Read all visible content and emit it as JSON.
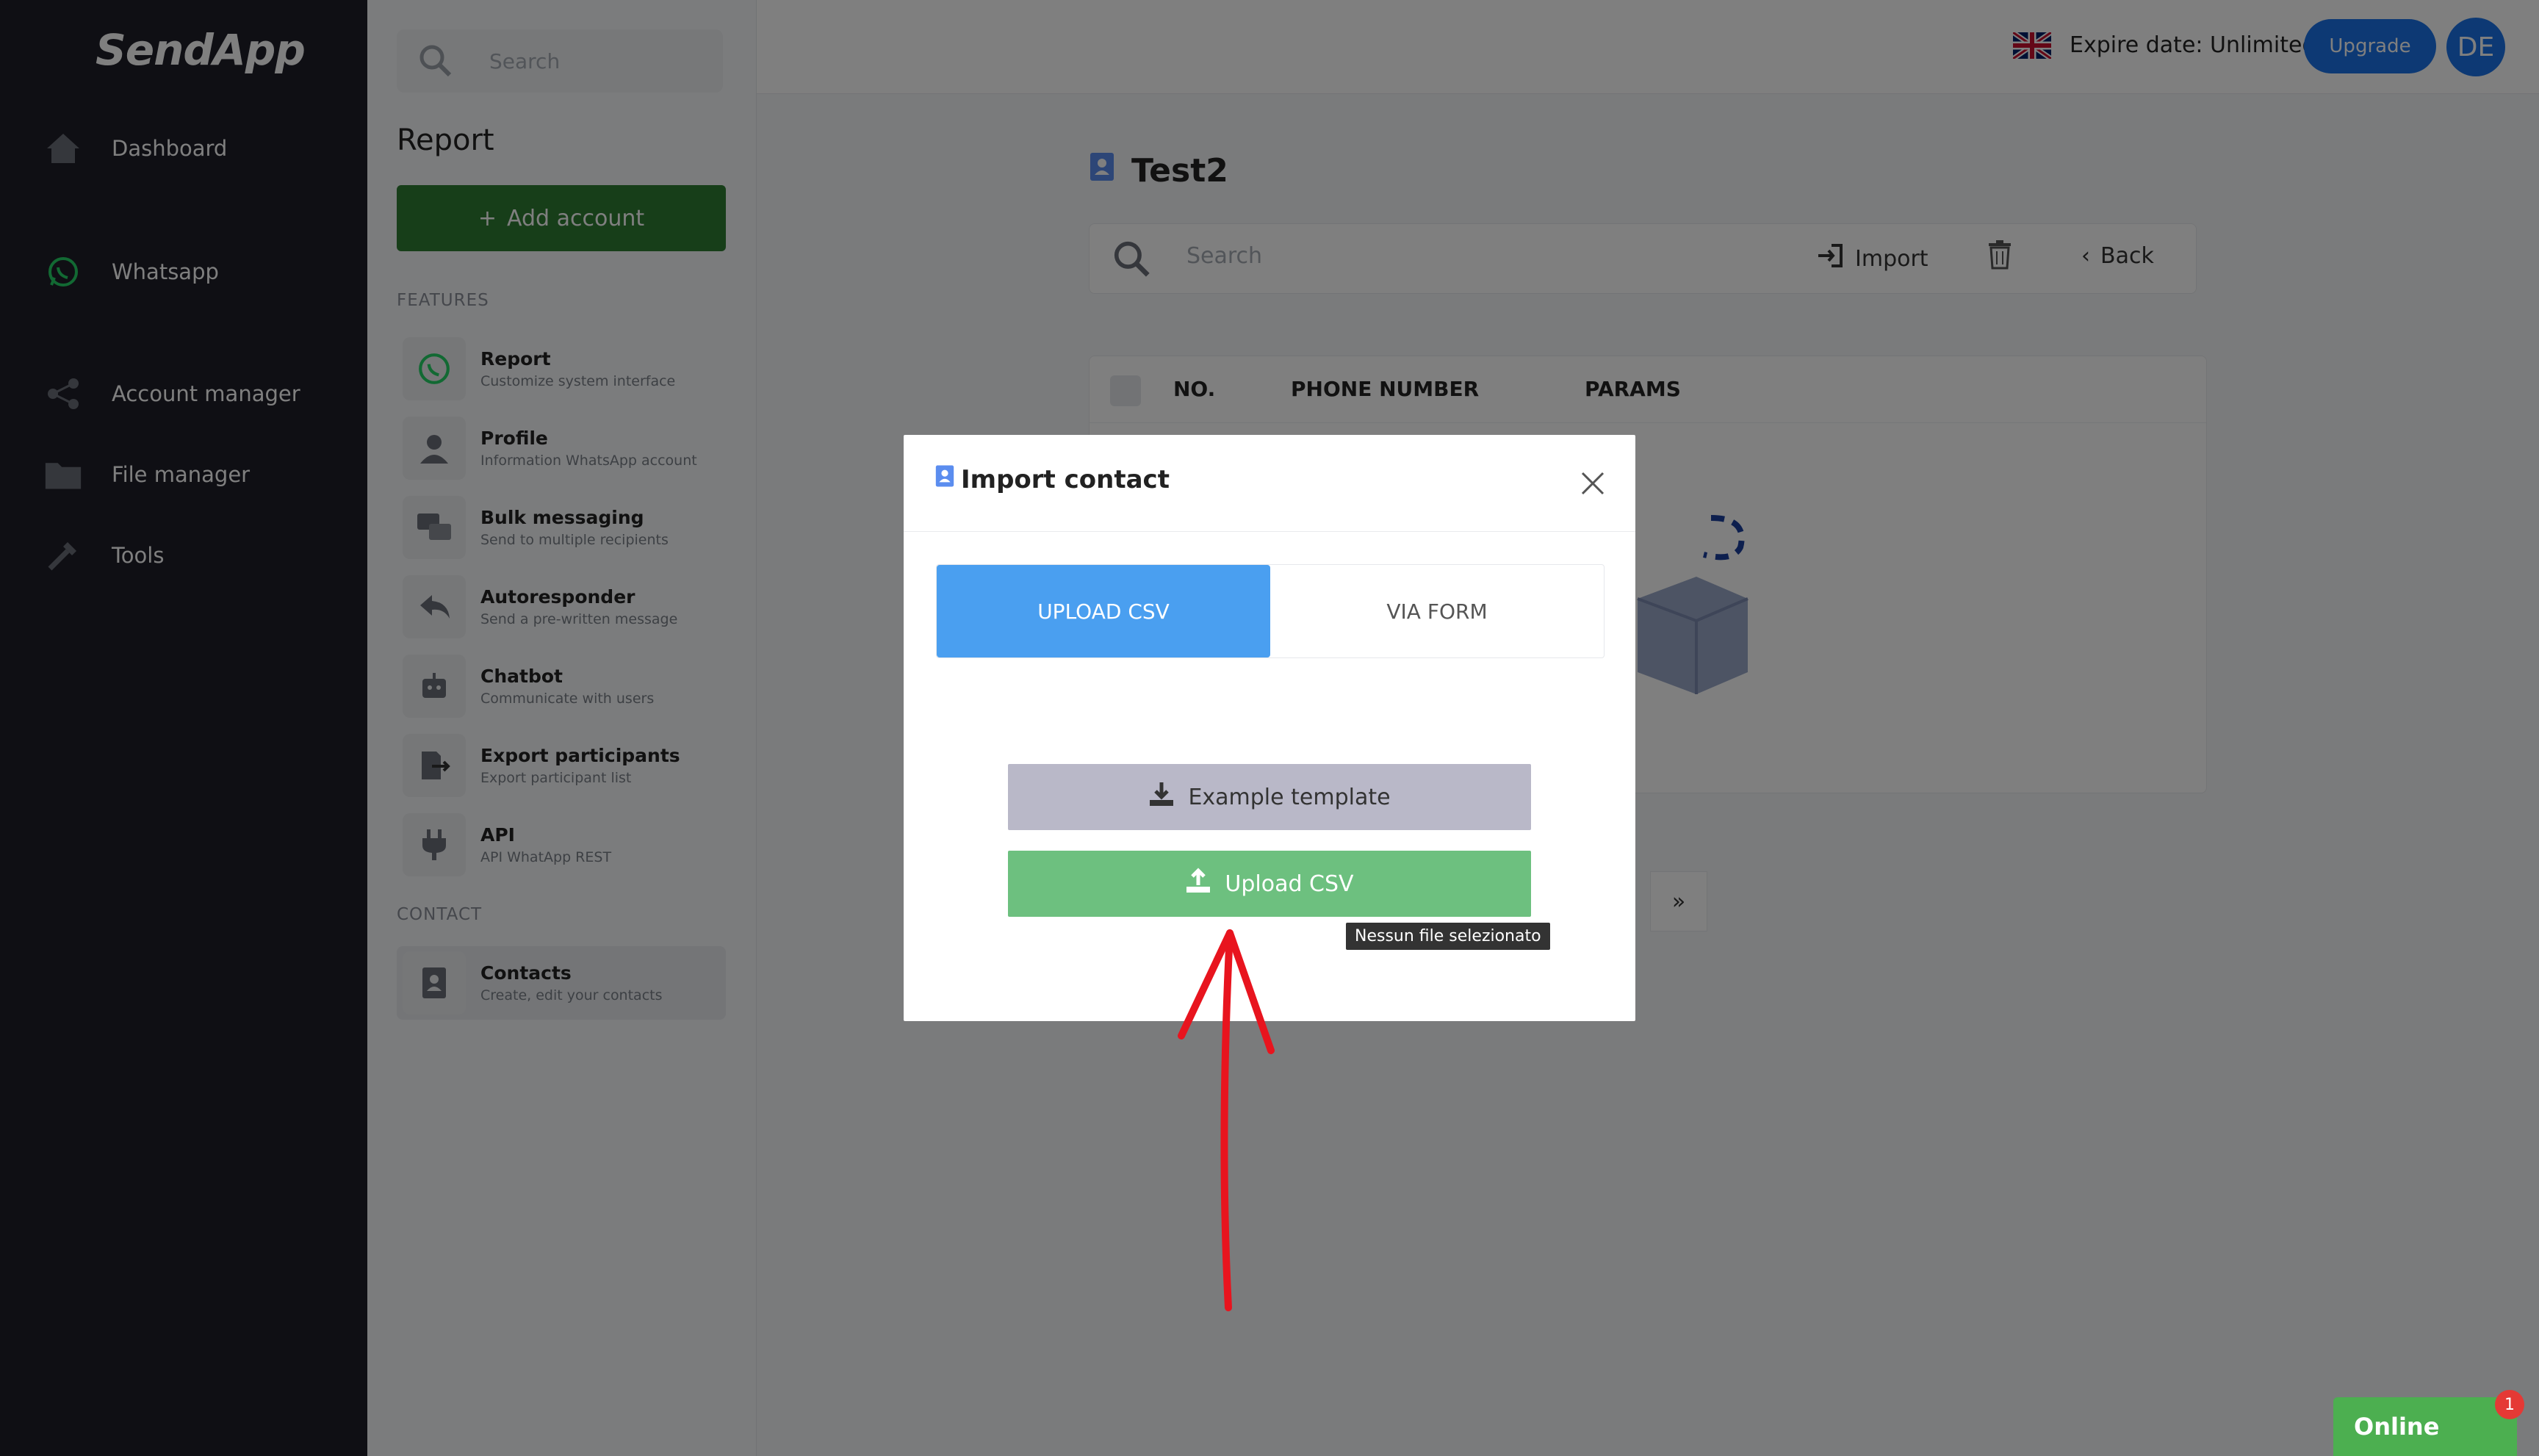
{
  "app": {
    "brand": "SendApp"
  },
  "nav": {
    "items": [
      {
        "label": "Dashboard",
        "icon": "home-icon"
      },
      {
        "label": "Whatsapp",
        "icon": "whatsapp-icon"
      },
      {
        "label": "Account manager",
        "icon": "share-nodes-icon"
      },
      {
        "label": "File manager",
        "icon": "folder-icon"
      },
      {
        "label": "Tools",
        "icon": "tools-icon"
      }
    ]
  },
  "panel": {
    "search_placeholder": "Search",
    "title": "Report",
    "add_account_label": "Add account",
    "features_label": "FEATURES",
    "features": [
      {
        "title": "Report",
        "subtitle": "Customize system interface",
        "icon": "whatsapp-icon"
      },
      {
        "title": "Profile",
        "subtitle": "Information WhatsApp account",
        "icon": "user-icon"
      },
      {
        "title": "Bulk messaging",
        "subtitle": "Send to multiple recipients",
        "icon": "chat-bubbles-icon"
      },
      {
        "title": "Autoresponder",
        "subtitle": "Send a pre-written message",
        "icon": "reply-icon"
      },
      {
        "title": "Chatbot",
        "subtitle": "Communicate with users",
        "icon": "robot-icon"
      },
      {
        "title": "Export participants",
        "subtitle": "Export participant list",
        "icon": "export-icon"
      },
      {
        "title": "API",
        "subtitle": "API WhatApp REST",
        "icon": "plug-icon"
      }
    ],
    "contact_label": "CONTACT",
    "contacts": {
      "title": "Contacts",
      "subtitle": "Create, edit your contacts",
      "icon": "contact-book-icon"
    }
  },
  "topbar": {
    "expire_text": "Expire date: Unlimited",
    "upgrade_label": "Upgrade",
    "avatar_initials": "DE",
    "flag": "uk-flag-icon"
  },
  "main": {
    "title": "Test2",
    "search_placeholder": "Search",
    "import_label": "Import",
    "back_label": "Back",
    "columns": [
      "NO.",
      "PHONE NUMBER",
      "PARAMS"
    ],
    "pager_next": "»"
  },
  "modal": {
    "title": "Import contact",
    "tabs": [
      {
        "label": "UPLOAD CSV",
        "active": true
      },
      {
        "label": "VIA FORM",
        "active": false
      }
    ],
    "example_label": "Example template",
    "upload_label": "Upload CSV",
    "file_status": "Nessun file selezionato"
  },
  "chat": {
    "label": "Online",
    "badge": "1"
  },
  "colors": {
    "accent": "#1a73e8",
    "success": "#2e7d32",
    "upload_green": "#6dc07f",
    "tab_active": "#4a9ff0",
    "sidebar_bg": "#1e1e28",
    "annotation_red": "#e8141e"
  }
}
